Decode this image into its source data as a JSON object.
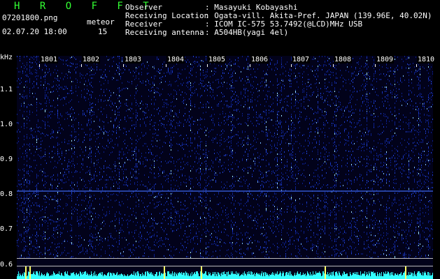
{
  "header": {
    "brand": "H R O F F T",
    "filename": "07201800.png",
    "category": "meteor",
    "datetime": "02.07.20 18:00",
    "count": "15",
    "fields": [
      {
        "label": "Observer",
        "value": ": Masayuki Kobayashi"
      },
      {
        "label": "Receiving Location",
        "value": ": Ogata-vill. Akita-Pref. JAPAN (139.96E, 40.02N)"
      },
      {
        "label": "Receiver",
        "value": ": ICOM IC-575 53.7492(@LCD)MHz USB"
      },
      {
        "label": "Receiving antenna",
        "value": ": A504HB(yagi 4el)"
      }
    ]
  },
  "axis": {
    "unit": "kHz",
    "y_labels": [
      "1.1",
      "1.0",
      "0.9",
      "0.8",
      "0.7",
      "0.6"
    ]
  },
  "time_labels": [
    "1801",
    "1802",
    "1803",
    "1804",
    "1805",
    "1806",
    "1807",
    "1808",
    "1809",
    "1810"
  ],
  "colors": {
    "brand": "#33ff33",
    "background": "#000000",
    "signal_low": "#0a1a8a",
    "signal_high": "#8fd0ff",
    "bottom_trace": "#33ffff",
    "meteor_pip": "#ffff66"
  }
}
